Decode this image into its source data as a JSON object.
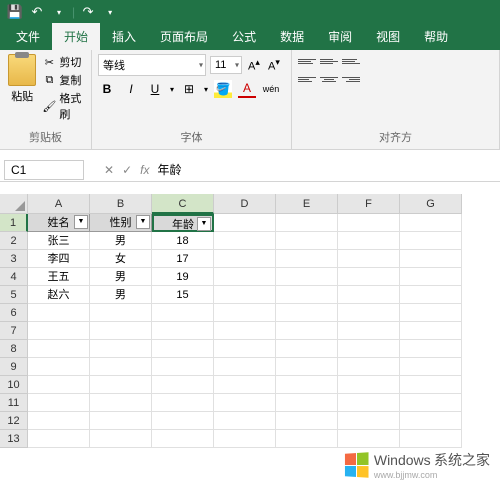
{
  "titlebar": {
    "save_icon": "💾",
    "undo_icon": "↶",
    "redo_icon": "↷"
  },
  "tabs": {
    "file": "文件",
    "home": "开始",
    "insert": "插入",
    "page_layout": "页面布局",
    "formulas": "公式",
    "data": "数据",
    "review": "审阅",
    "view": "视图",
    "help": "帮助"
  },
  "ribbon": {
    "clipboard": {
      "paste": "粘贴",
      "cut": "剪切",
      "copy": "复制",
      "format_painter": "格式刷",
      "label": "剪贴板"
    },
    "font": {
      "name": "等线",
      "size": "11",
      "bold": "B",
      "italic": "I",
      "underline": "U",
      "label": "字体",
      "wen": "wén"
    },
    "align": {
      "label": "对齐方"
    }
  },
  "formula_bar": {
    "name_box": "C1",
    "fx": "fx",
    "content": "年龄"
  },
  "columns": [
    "A",
    "B",
    "C",
    "D",
    "E",
    "F",
    "G"
  ],
  "rows": [
    "1",
    "2",
    "3",
    "4",
    "5",
    "6",
    "7",
    "8",
    "9",
    "10",
    "11",
    "12",
    "13"
  ],
  "chart_data": {
    "type": "table",
    "headers": [
      "姓名",
      "性别",
      "年龄"
    ],
    "data": [
      {
        "姓名": "张三",
        "性别": "男",
        "年龄": 18
      },
      {
        "姓名": "李四",
        "性别": "女",
        "年龄": 17
      },
      {
        "姓名": "王五",
        "性别": "男",
        "年龄": 19
      },
      {
        "姓名": "赵六",
        "性别": "男",
        "年龄": 15
      }
    ]
  },
  "selected_cell": "C1",
  "watermark": {
    "main": "Windows",
    "sub": "系统之家",
    "url": "www.bjjmw.com"
  }
}
